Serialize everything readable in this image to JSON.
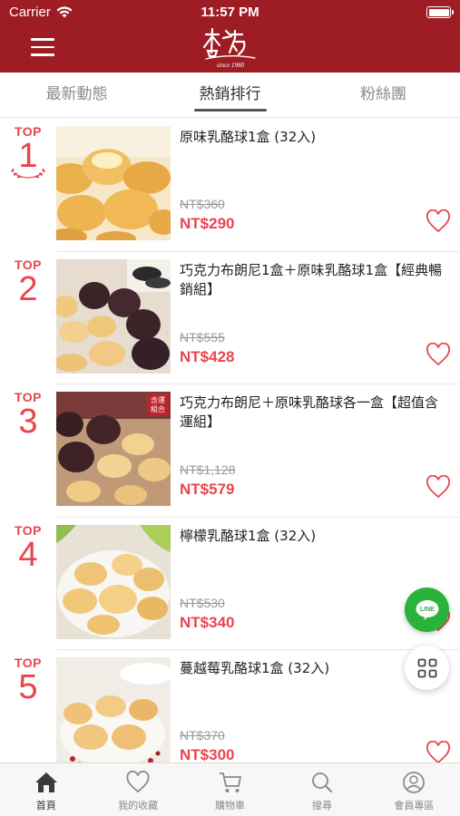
{
  "status_bar": {
    "carrier": "Carrier",
    "time": "11:57 PM"
  },
  "brand": {
    "logo_text": "杏芳",
    "logo_since": "since 1980",
    "primary_color": "#9e1d24",
    "accent_color": "#e8454d"
  },
  "tabs": [
    {
      "label": "最新動態",
      "active": false
    },
    {
      "label": "熱銷排行",
      "active": true
    },
    {
      "label": "粉絲團",
      "active": false
    }
  ],
  "ranking": [
    {
      "top_label": "TOP",
      "rank": "1",
      "title": "原味乳酪球1盒 (32入)",
      "old_price": "NT$360",
      "price": "NT$290"
    },
    {
      "top_label": "TOP",
      "rank": "2",
      "title": "巧克力布朗尼1盒＋原味乳酪球1盒【經典暢銷組】",
      "old_price": "NT$555",
      "price": "NT$428"
    },
    {
      "top_label": "TOP",
      "rank": "3",
      "title": "巧克力布朗尼＋原味乳酪球各一盒【超值含運組】",
      "old_price": "NT$1,128",
      "price": "NT$579",
      "image_badge": "含運組合"
    },
    {
      "top_label": "TOP",
      "rank": "4",
      "title": "檸檬乳酪球1盒 (32入)",
      "old_price": "NT$530",
      "price": "NT$340"
    },
    {
      "top_label": "TOP",
      "rank": "5",
      "title": "蔓越莓乳酪球1盒 (32入)",
      "old_price": "NT$370",
      "price": "NT$300"
    }
  ],
  "floating": {
    "line_label": "LINE"
  },
  "tabbar": [
    {
      "label": "首頁",
      "icon": "home-icon",
      "active": true
    },
    {
      "label": "我的收藏",
      "icon": "heart-icon",
      "active": false
    },
    {
      "label": "購物車",
      "icon": "cart-icon",
      "active": false
    },
    {
      "label": "搜尋",
      "icon": "search-icon",
      "active": false
    },
    {
      "label": "會員專區",
      "icon": "user-icon",
      "active": false
    }
  ]
}
